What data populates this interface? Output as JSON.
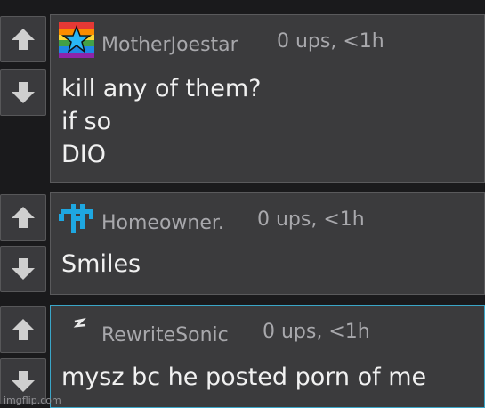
{
  "comments": [
    {
      "username": "MotherJoestar",
      "meta": "0 ups, <1h",
      "lines": [
        "kill any of them?",
        "if so",
        "DIO"
      ],
      "upvote_icon": "up-arrow",
      "downvote_icon": "down-arrow",
      "avatar_icon": "rainbow-star-avatar"
    },
    {
      "username": "Homeowner.",
      "meta": "0 ups, <1h",
      "lines": [
        "Smiles"
      ],
      "upvote_icon": "up-arrow",
      "downvote_icon": "down-arrow",
      "avatar_icon": "blue-pixel-avatar"
    },
    {
      "username": "RewriteSonic",
      "meta": "0 ups, <1h",
      "lines": [
        "mysz bc he posted porn of me"
      ],
      "upvote_icon": "up-arrow",
      "downvote_icon": "down-arrow",
      "avatar_icon": "lightning-avatar"
    }
  ],
  "watermark": "imgflip.com",
  "colors": {
    "background": "#1a1a1c",
    "panel": "#3b3b3d",
    "highlight_border": "#3aa6c8",
    "meta_text": "#a8a8ac"
  }
}
